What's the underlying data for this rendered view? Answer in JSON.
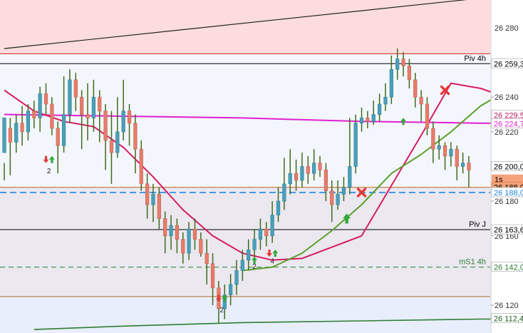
{
  "chart_data": {
    "type": "candlestick",
    "y_range": [
      26104,
      26296
    ],
    "y_ticks": [
      {
        "value": 26240,
        "label": "26 240"
      },
      {
        "value": 26220,
        "label": "26 220"
      },
      {
        "value": 26180,
        "label": "26 180"
      },
      {
        "value": 26160,
        "label": "26 160"
      },
      {
        "value": 26120,
        "label": "26 120"
      }
    ],
    "top_cut_tick": {
      "value": 26280,
      "label": "26 280"
    },
    "price_tags": [
      {
        "value": 26259.3,
        "label": "26 259,3",
        "text_color": "#000000",
        "bg": "#ffffff",
        "border": "#bbbbbb"
      },
      {
        "value": 26229.5,
        "label": "26 229,5",
        "text_color": "#c2185b",
        "bg": "#ffffff",
        "border": "#bbbbbb"
      },
      {
        "value": 26224.7,
        "label": "26 224,7",
        "text_color": "#e020d0",
        "bg": "#ffffff",
        "border": "#bbbbbb"
      },
      {
        "value": 26200.0,
        "label": "26 200,0",
        "text_color": "#000000",
        "bg": "#ffffff",
        "border": "#bbbbbb"
      },
      {
        "value": 26188.0,
        "label": "26 188,0",
        "text_color": "#000000",
        "bg": "#f4a37a",
        "border": "#e08050"
      },
      {
        "value": 26185.0,
        "label": "26 188,0",
        "text_color": "#1e88e5",
        "bg": "#ffffff",
        "border": "#bbbbbb"
      },
      {
        "value": 26163.6,
        "label": "26 163,6",
        "text_color": "#000000",
        "bg": "#ffffff",
        "border": "#bbbbbb"
      },
      {
        "value": 26142.0,
        "label": "26 142,0",
        "text_color": "#2e7d32",
        "bg": "#ffffff",
        "border": "#bbbbbb"
      },
      {
        "value": 26112.4,
        "label": "26 112,4",
        "text_color": "#1b5e20",
        "bg": "#ffffff",
        "border": "#bbbbbb"
      }
    ],
    "timer_tag": {
      "value": 26192.5,
      "label": "1s",
      "bg": "#f4a37a",
      "text_color": "#000000"
    },
    "levels": [
      {
        "value": 26259.3,
        "label": "Piv 4h",
        "color": "#000000",
        "style": "solid"
      },
      {
        "value": 26163.6,
        "label": "Piv J",
        "color": "#000000",
        "style": "solid"
      },
      {
        "value": 26142.0,
        "label": "mS1 4h",
        "color": "#2e7d32",
        "style": "dashed"
      },
      {
        "value": 26185.0,
        "label": "",
        "color": "#1e88e5",
        "style": "dashed"
      },
      {
        "value": 26188.0,
        "label": "",
        "color": "#b5651d",
        "style": "solid"
      },
      {
        "value": 26125.0,
        "label": "",
        "color": "#b5651d",
        "style": "solid"
      },
      {
        "value": 26265.0,
        "label": "",
        "color": "#c62828",
        "style": "solid"
      }
    ],
    "zones": [
      {
        "from": 26265,
        "to": 26296,
        "color": "#fcdcdc"
      },
      {
        "from": 26188,
        "to": 26265,
        "color": "#f4f6fd"
      },
      {
        "from": 26125,
        "to": 26188,
        "color": "#ebe8f0"
      },
      {
        "from": 26104,
        "to": 26125,
        "color": "#e8eefc"
      }
    ],
    "trendline": {
      "from": [
        0,
        26268
      ],
      "to": [
        88,
        26300
      ],
      "color": "#222222"
    },
    "magenta_line": {
      "color": "#e020d0",
      "x": [
        0,
        20,
        40,
        60,
        80,
        95
      ],
      "y": [
        26230,
        26229,
        26228,
        26226,
        26225,
        26224.7
      ]
    },
    "red_ma": {
      "color": "#d81b60",
      "x": [
        0,
        5,
        10,
        15,
        20,
        25,
        30,
        35,
        40,
        45,
        50,
        60,
        70,
        75,
        80,
        85,
        90,
        94
      ],
      "y": [
        26244,
        26232,
        26226,
        26223,
        26211,
        26194,
        26175,
        26160,
        26150,
        26146,
        26147,
        26160,
        26218,
        26248,
        26245,
        26239,
        26232,
        26229.5
      ]
    },
    "green_ma": {
      "color": "#5aa02c",
      "x": [
        40,
        45,
        50,
        55,
        60,
        65,
        70,
        75,
        80,
        85,
        90,
        95
      ],
      "y": [
        26140,
        26142,
        26150,
        26163,
        26178,
        26196,
        26207,
        26220,
        26235,
        26245,
        26248,
        26252
      ]
    },
    "bottom_ma": {
      "color": "#2e7d32",
      "x": [
        5,
        20,
        40,
        60,
        80,
        95
      ],
      "y": [
        26106,
        26108,
        26110,
        26111,
        26112,
        26112.4
      ]
    },
    "candles": [
      [
        26208,
        26228,
        26202,
        26192
      ],
      [
        26222,
        26214,
        26228,
        26195
      ],
      [
        26214,
        26225,
        26230,
        26208
      ],
      [
        26225,
        26220,
        26235,
        26212
      ],
      [
        26220,
        26232,
        26236,
        26215
      ],
      [
        26232,
        26228,
        26238,
        26222
      ],
      [
        26228,
        26242,
        26246,
        26220
      ],
      [
        26242,
        26236,
        26248,
        26230
      ],
      [
        26236,
        26222,
        26240,
        26218
      ],
      [
        26222,
        26212,
        26226,
        26196
      ],
      [
        26212,
        26230,
        26252,
        26208
      ],
      [
        26230,
        26250,
        26256,
        26225
      ],
      [
        26250,
        26240,
        26254,
        26232
      ],
      [
        26240,
        26230,
        26244,
        26210
      ],
      [
        26230,
        26228,
        26248,
        26215
      ],
      [
        26228,
        26240,
        26250,
        26220
      ],
      [
        26240,
        26232,
        26244,
        26214
      ],
      [
        26232,
        26215,
        26236,
        26198
      ],
      [
        26215,
        26208,
        26232,
        26190
      ],
      [
        26208,
        26220,
        26240,
        26205
      ],
      [
        26220,
        26232,
        26250,
        26215
      ],
      [
        26232,
        26225,
        26236,
        26212
      ],
      [
        26225,
        26210,
        26230,
        26196
      ],
      [
        26210,
        26190,
        26215,
        26186
      ],
      [
        26190,
        26178,
        26196,
        26170
      ],
      [
        26178,
        26184,
        26190,
        26168
      ],
      [
        26184,
        26170,
        26188,
        26164
      ],
      [
        26170,
        26160,
        26174,
        26150
      ],
      [
        26160,
        26166,
        26172,
        26152
      ],
      [
        26166,
        26158,
        26170,
        26150
      ],
      [
        26158,
        26150,
        26162,
        26144
      ],
      [
        26150,
        26164,
        26168,
        26146
      ],
      [
        26164,
        26158,
        26170,
        26152
      ],
      [
        26158,
        26150,
        26162,
        26148
      ],
      [
        26150,
        26144,
        26158,
        26132
      ],
      [
        26144,
        26130,
        26150,
        26120
      ],
      [
        26130,
        26118,
        26134,
        26110
      ],
      [
        26118,
        26126,
        26132,
        26112
      ],
      [
        26126,
        26132,
        26138,
        26120
      ],
      [
        26132,
        26140,
        26146,
        26126
      ],
      [
        26140,
        26146,
        26152,
        26134
      ],
      [
        26146,
        26152,
        26158,
        26140
      ],
      [
        26152,
        26158,
        26164,
        26146
      ],
      [
        26158,
        26164,
        26170,
        26152
      ],
      [
        26164,
        26160,
        26168,
        26154
      ],
      [
        26160,
        26172,
        26180,
        26156
      ],
      [
        26172,
        26180,
        26188,
        26168
      ],
      [
        26180,
        26190,
        26205,
        26175
      ],
      [
        26190,
        26196,
        26210,
        26184
      ],
      [
        26196,
        26192,
        26204,
        26186
      ],
      [
        26192,
        26200,
        26208,
        26188
      ],
      [
        26200,
        26196,
        26206,
        26190
      ],
      [
        26196,
        26202,
        26210,
        26192
      ],
      [
        26202,
        26198,
        26206,
        26194
      ],
      [
        26198,
        26186,
        26202,
        26180
      ],
      [
        26186,
        26178,
        26192,
        26168
      ],
      [
        26178,
        26184,
        26192,
        26175
      ],
      [
        26184,
        26188,
        26194,
        26180
      ],
      [
        26188,
        26200,
        26228,
        26184
      ],
      [
        26200,
        26225,
        26230,
        26196
      ],
      [
        26225,
        26228,
        26234,
        26220
      ],
      [
        26228,
        26226,
        26232,
        26222
      ],
      [
        26226,
        26230,
        26238,
        26224
      ],
      [
        26230,
        26236,
        26242,
        26226
      ],
      [
        26236,
        26240,
        26248,
        26232
      ],
      [
        26240,
        26256,
        26264,
        26236
      ],
      [
        26256,
        26262,
        26268,
        26250
      ],
      [
        26262,
        26258,
        26266,
        26252
      ],
      [
        26258,
        26250,
        26262,
        26245
      ],
      [
        26250,
        26240,
        26254,
        26234
      ],
      [
        26240,
        26236,
        26244,
        26226
      ],
      [
        26236,
        26222,
        26240,
        26218
      ],
      [
        26222,
        26210,
        26226,
        26202
      ],
      [
        26210,
        26212,
        26218,
        26204
      ],
      [
        26212,
        26206,
        26214,
        26198
      ],
      [
        26206,
        26210,
        26214,
        26200
      ],
      [
        26210,
        26200,
        26212,
        26192
      ],
      [
        26200,
        26202,
        26208,
        26196
      ],
      [
        26202,
        26198,
        26206,
        26188
      ]
    ],
    "annotations": [
      {
        "kind": "up_arrow",
        "x": 8,
        "y": 26204
      },
      {
        "kind": "down_arrow",
        "x": 7,
        "y": 26204
      },
      {
        "kind": "label",
        "x": 7.5,
        "y": 26196,
        "text": "2"
      },
      {
        "kind": "down_arrow",
        "x": 36,
        "y": 26124
      },
      {
        "kind": "up_arrow",
        "x": 37,
        "y": 26124
      },
      {
        "kind": "label",
        "x": 36.5,
        "y": 26116,
        "text": "2"
      },
      {
        "kind": "up_arrow",
        "x": 42,
        "y": 26146
      },
      {
        "kind": "label",
        "x": 42,
        "y": 26141,
        "text": "2"
      },
      {
        "kind": "down_arrow",
        "x": 44.5,
        "y": 26150
      },
      {
        "kind": "up_arrow",
        "x": 45.5,
        "y": 26150
      },
      {
        "kind": "label",
        "x": 45,
        "y": 26144,
        "text": "4"
      },
      {
        "kind": "cross",
        "x": 60,
        "y": 26185
      },
      {
        "kind": "up_arrow_big",
        "x": 57.5,
        "y": 26170
      },
      {
        "kind": "up_arrow",
        "x": 67,
        "y": 26226
      },
      {
        "kind": "cross",
        "x": 74,
        "y": 26244
      }
    ]
  }
}
